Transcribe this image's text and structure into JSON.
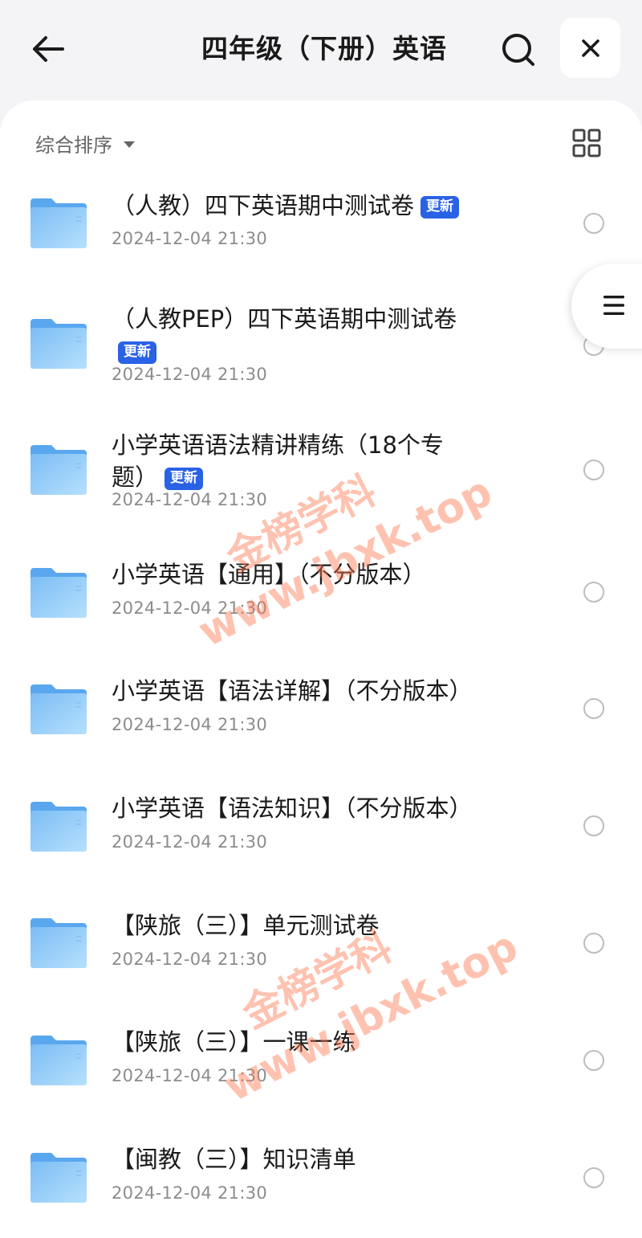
{
  "header": {
    "title": "四年级（下册）英语",
    "back_icon": "arrow-left-icon",
    "search_icon": "search-icon",
    "close_icon": "close-icon"
  },
  "toolbar": {
    "sort_label": "综合排序",
    "view_icon": "grid-view-icon"
  },
  "side_tab_icon": "menu-icon",
  "badge_label": "更新",
  "items": [
    {
      "title": "（人教）四下英语期中测试卷",
      "badge": true,
      "date": "2024-12-04 21:30"
    },
    {
      "title": "（人教PEP）四下英语期中测试卷",
      "badge": true,
      "date": "2024-12-04 21:30"
    },
    {
      "title": "小学英语语法精讲精练（18个专题）",
      "badge": true,
      "date": "2024-12-04 21:30"
    },
    {
      "title": "小学英语【通用】（不分版本）",
      "badge": false,
      "date": "2024-12-04 21:30"
    },
    {
      "title": "小学英语【语法详解】（不分版本）",
      "badge": false,
      "date": "2024-12-04 21:30"
    },
    {
      "title": "小学英语【语法知识】（不分版本）",
      "badge": false,
      "date": "2024-12-04 21:30"
    },
    {
      "title": "【陕旅（三）】单元测试卷",
      "badge": false,
      "date": "2024-12-04 21:30"
    },
    {
      "title": "【陕旅（三）】一课一练",
      "badge": false,
      "date": "2024-12-04 21:30"
    },
    {
      "title": "【闽教（三）】知识清单",
      "badge": false,
      "date": "2024-12-04 21:30"
    }
  ],
  "watermark": {
    "line1": "金榜学科",
    "line2": "www.jbxk.top"
  },
  "colors": {
    "accent": "#2a62e6",
    "folder_light": "#aedcfb",
    "folder_dark": "#5aa7ef",
    "watermark": "#ff7850"
  }
}
